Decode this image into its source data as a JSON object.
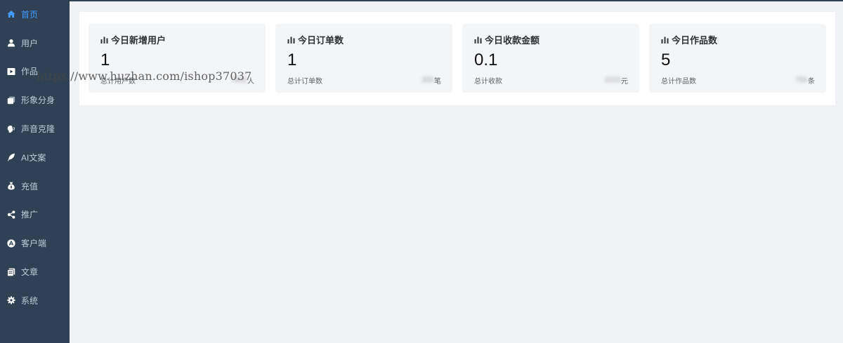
{
  "sidebar": {
    "items": [
      {
        "label": "首页",
        "icon": "home-icon",
        "active": true
      },
      {
        "label": "用户",
        "icon": "user-icon"
      },
      {
        "label": "作品",
        "icon": "video-icon"
      },
      {
        "label": "形象分身",
        "icon": "copy-icon"
      },
      {
        "label": "声音克隆",
        "icon": "voice-icon"
      },
      {
        "label": "AI文案",
        "icon": "feather-icon"
      },
      {
        "label": "充值",
        "icon": "money-bag-icon"
      },
      {
        "label": "推广",
        "icon": "share-icon"
      },
      {
        "label": "客户端",
        "icon": "app-store-icon"
      },
      {
        "label": "文章",
        "icon": "document-icon"
      },
      {
        "label": "系统",
        "icon": "gear-icon"
      }
    ],
    "background": "#304156",
    "text_color": "#bfcbd9",
    "active_color": "#409eff"
  },
  "stats": {
    "cards": [
      {
        "title": "今日新增用户",
        "value": "1",
        "sub_label": "总计用户数",
        "total": "7800",
        "unit": "人"
      },
      {
        "title": "今日订单数",
        "value": "1",
        "sub_label": "总计订单数",
        "total": "300",
        "unit": "笔"
      },
      {
        "title": "今日收款金额",
        "value": "0.1",
        "sub_label": "总计收款",
        "total": "1015",
        "unit": "元"
      },
      {
        "title": "今日作品数",
        "value": "5",
        "sub_label": "总计作品数",
        "total": "756",
        "unit": "条"
      }
    ]
  },
  "watermark": "https://www.huzhan.com/ishop37037"
}
